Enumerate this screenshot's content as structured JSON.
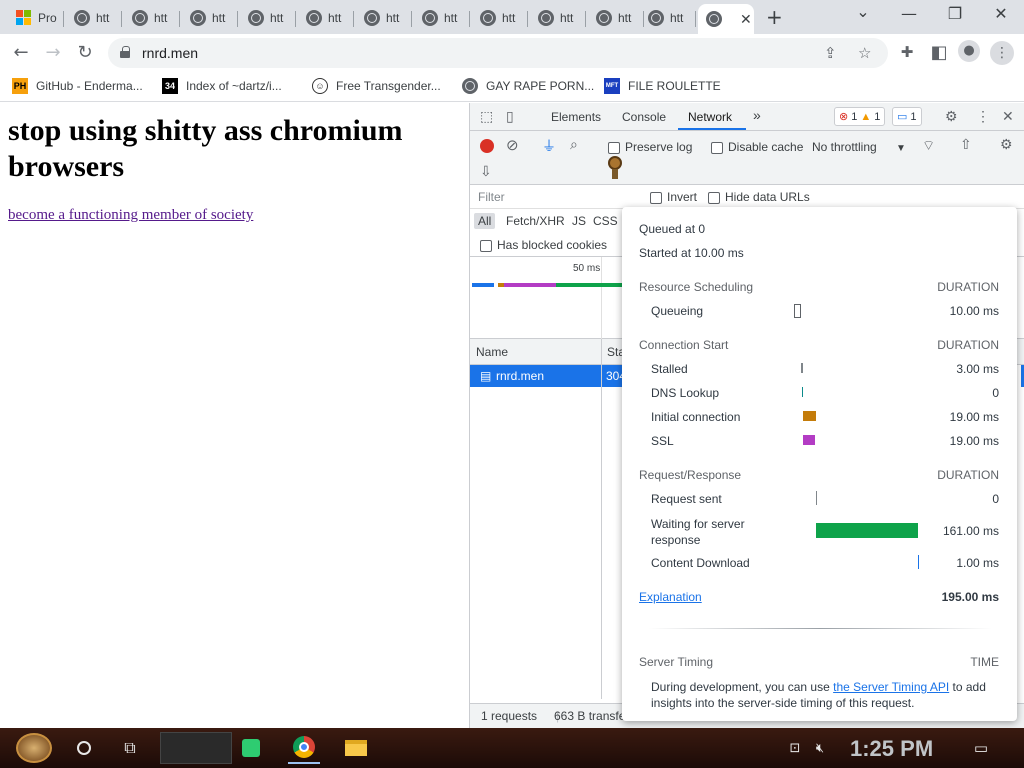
{
  "tabs": {
    "items": [
      {
        "label": "Pro",
        "favicon": "microsoft-logo"
      },
      {
        "label": "htt",
        "favicon": "globe"
      },
      {
        "label": "htt",
        "favicon": "globe"
      },
      {
        "label": "htt",
        "favicon": "globe"
      },
      {
        "label": "htt",
        "favicon": "globe"
      },
      {
        "label": "htt",
        "favicon": "globe"
      },
      {
        "label": "htt",
        "favicon": "globe"
      },
      {
        "label": "htt",
        "favicon": "globe"
      },
      {
        "label": "htt",
        "favicon": "globe"
      },
      {
        "label": "htt",
        "favicon": "globe"
      },
      {
        "label": "htt",
        "favicon": "globe"
      },
      {
        "label": "htt",
        "favicon": "globe"
      }
    ],
    "close_glyph": "✕",
    "new_tab_glyph": "+"
  },
  "window": {
    "tab_list": "⌄",
    "minimize": "—",
    "restore": "❐",
    "close": "✕"
  },
  "address": {
    "url": "rnrd.men"
  },
  "bookmarks": [
    {
      "label": "GitHub - Enderma...",
      "icon": "PH",
      "color": "#f6a00c"
    },
    {
      "label": "Index of ~dartz/i...",
      "icon": "34",
      "color": "#000000"
    },
    {
      "label": "Free Transgender...",
      "icon": "face-icon",
      "color": "#333333"
    },
    {
      "label": "GAY RAPE PORN...",
      "icon": "globe",
      "color": "#333333"
    },
    {
      "label": "FILE ROULETTE",
      "icon": "MFT",
      "color": "#1a3fbf"
    }
  ],
  "page": {
    "heading": "stop using shitty ass chromium browsers",
    "link": "become a functioning member of society"
  },
  "devtools": {
    "tabs": [
      "Elements",
      "Console",
      "Network"
    ],
    "more": "»",
    "errors": "1",
    "warnings": "1",
    "messages": "1",
    "preserve_log": "Preserve log",
    "disable_cache": "Disable cache",
    "throttling": "No throttling",
    "filter_placeholder": "Filter",
    "invert": "Invert",
    "hide_data_urls": "Hide data URLs",
    "types": [
      "All",
      "Fetch/XHR",
      "JS",
      "CSS"
    ],
    "has_blocked_cookies": "Has blocked cookies",
    "timeline_tick": "50 ms",
    "col_name": "Name",
    "col_status": "Sta",
    "request_name": "rnrd.men",
    "request_status": "304",
    "summary_requests": "1 requests",
    "summary_transferred": "663 B transfe"
  },
  "timing": {
    "queued_at": "Queued at 0",
    "started_at": "Started at 10.00 ms",
    "duration_label": "DURATION",
    "resource_scheduling": "Resource Scheduling",
    "queueing": {
      "label": "Queueing",
      "value": "10.00 ms"
    },
    "connection_start": "Connection Start",
    "stalled": {
      "label": "Stalled",
      "value": "3.00 ms"
    },
    "dns": {
      "label": "DNS Lookup",
      "value": "0"
    },
    "initial_connection": {
      "label": "Initial connection",
      "value": "19.00 ms",
      "color": "#c47c0a"
    },
    "ssl": {
      "label": "SSL",
      "value": "19.00 ms",
      "color": "#b33cc4"
    },
    "request_response": "Request/Response",
    "request_sent": {
      "label": "Request sent",
      "value": "0"
    },
    "waiting": {
      "label": "Waiting for server response",
      "value": "161.00 ms",
      "color": "#0ea34a"
    },
    "download": {
      "label": "Content Download",
      "value": "1.00 ms",
      "color": "#1a73e8"
    },
    "explanation": "Explanation",
    "total": "195.00 ms",
    "server_timing": "Server Timing",
    "time_label": "TIME",
    "server_note_pre": "During development, you can use",
    "server_note_link": "the Server Timing API",
    "server_note_post": "to add insights into the server-side timing of this request."
  },
  "taskbar": {
    "clock": "1:25 PM"
  }
}
